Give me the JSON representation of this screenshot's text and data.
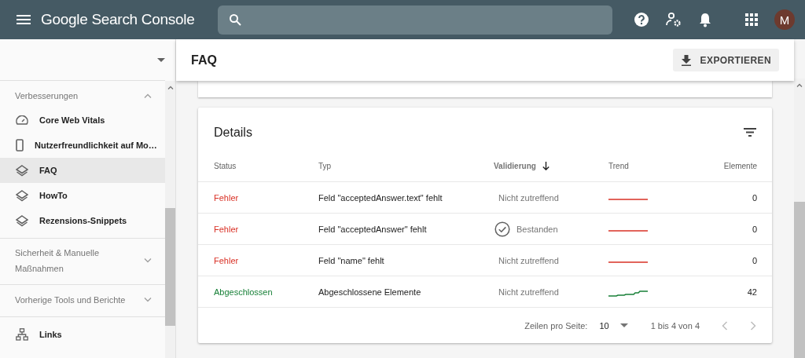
{
  "app": {
    "title": "Google Search Console",
    "avatar": "M"
  },
  "sidebar": {
    "sections": [
      {
        "title": "Verbesserungen",
        "expanded": true,
        "items": [
          {
            "label": "Core Web Vitals",
            "kind": "gauge",
            "selected": false
          },
          {
            "label": "Nutzerfreundlichkeit auf Mo…",
            "kind": "phone",
            "selected": false
          },
          {
            "label": "FAQ",
            "kind": "layers",
            "selected": true
          },
          {
            "label": "HowTo",
            "kind": "layers",
            "selected": false
          },
          {
            "label": "Rezensions-Snippets",
            "kind": "layers",
            "selected": false
          }
        ]
      },
      {
        "title": "Sicherheit & Manuelle Maßnahmen",
        "expanded": false
      },
      {
        "title": "Vorherige Tools und Berichte",
        "expanded": false
      }
    ],
    "bottom_items": [
      {
        "label": "Links",
        "kind": "network",
        "selected": false
      }
    ]
  },
  "page": {
    "title": "FAQ",
    "export_button": "EXPORTIEREN"
  },
  "details": {
    "title": "Details",
    "columns": [
      {
        "label": "Status",
        "sorted": false
      },
      {
        "label": "Typ",
        "sorted": false
      },
      {
        "label": "Validierung",
        "sorted": true
      },
      {
        "label": "Trend",
        "sorted": false
      },
      {
        "label": "Elemente",
        "sorted": false
      }
    ],
    "rows": [
      {
        "status": "Fehler",
        "kind": "error",
        "type": "Feld \"acceptedAnswer.text\" fehlt",
        "validation": "Nicht zutreffend",
        "passed": false,
        "count": "0"
      },
      {
        "status": "Fehler",
        "kind": "error",
        "type": "Feld \"acceptedAnswer\" fehlt",
        "validation": "Bestanden",
        "passed": true,
        "count": "0"
      },
      {
        "status": "Fehler",
        "kind": "error",
        "type": "Feld \"name\" fehlt",
        "validation": "Nicht zutreffend",
        "passed": false,
        "count": "0"
      },
      {
        "status": "Abgeschlossen",
        "kind": "done",
        "type": "Abgeschlossene Elemente",
        "validation": "Nicht zutreffend",
        "passed": false,
        "count": "42"
      }
    ],
    "pagination": {
      "rows_label": "Zeilen pro Seite:",
      "rows_value": "10",
      "range": "1 bis 4 von 4"
    }
  }
}
